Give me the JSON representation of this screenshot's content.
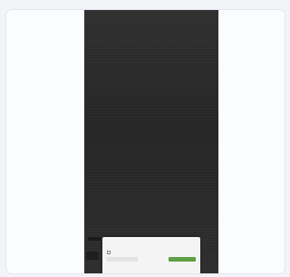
{
  "hero": {
    "title": "",
    "subtitle": "",
    "subtitle2": ""
  },
  "left": {
    "text": "",
    "footer": ""
  },
  "consent": {
    "title": "",
    "body": "",
    "checkbox_label": "",
    "secondary_button": "",
    "primary_button": "",
    "link": ""
  },
  "colors": {
    "accept_green": "#5fa046",
    "dark_background": "#2a2a2a"
  }
}
